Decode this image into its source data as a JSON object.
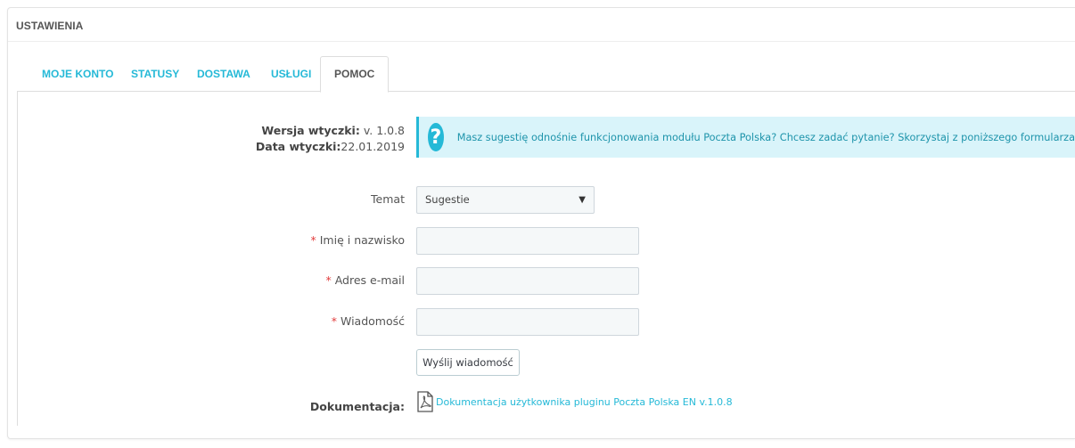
{
  "panel": {
    "title": "USTAWIENIA"
  },
  "tabs": [
    {
      "label": "MOJE KONTO"
    },
    {
      "label": "STATUSY"
    },
    {
      "label": "DOSTAWA"
    },
    {
      "label": "USŁUGI"
    },
    {
      "label": "POMOC",
      "active": true
    }
  ],
  "plugin_info": {
    "version_label": "Wersja wtyczki:",
    "version_value": " v. 1.0.8",
    "date_label": "Data wtyczki:",
    "date_value": "22.01.2019"
  },
  "alert": {
    "icon": "question-icon",
    "text": "Masz sugestię odnośnie funkcjonowania modułu Poczta Polska? Chcesz zadać pytanie? Skorzystaj z poniższego formularza"
  },
  "form": {
    "topic_label": "Temat",
    "topic_value": "Sugestie",
    "name_label": "Imię i nazwisko",
    "name_value": "",
    "email_label": "Adres e-mail",
    "email_value": "",
    "message_label": "Wiadomość",
    "message_value": "",
    "required_mark": "*",
    "submit_label": "Wyślij wiadomość"
  },
  "documentation": {
    "label": "Dokumentacja:",
    "icon": "pdf-icon",
    "link_text": "Dokumentacja użytkownika pluginu Poczta Polska EN v.1.0.8"
  },
  "colors": {
    "accent": "#25b9d7",
    "alert_bg": "#d9f4fa",
    "required": "#e23d3d"
  }
}
